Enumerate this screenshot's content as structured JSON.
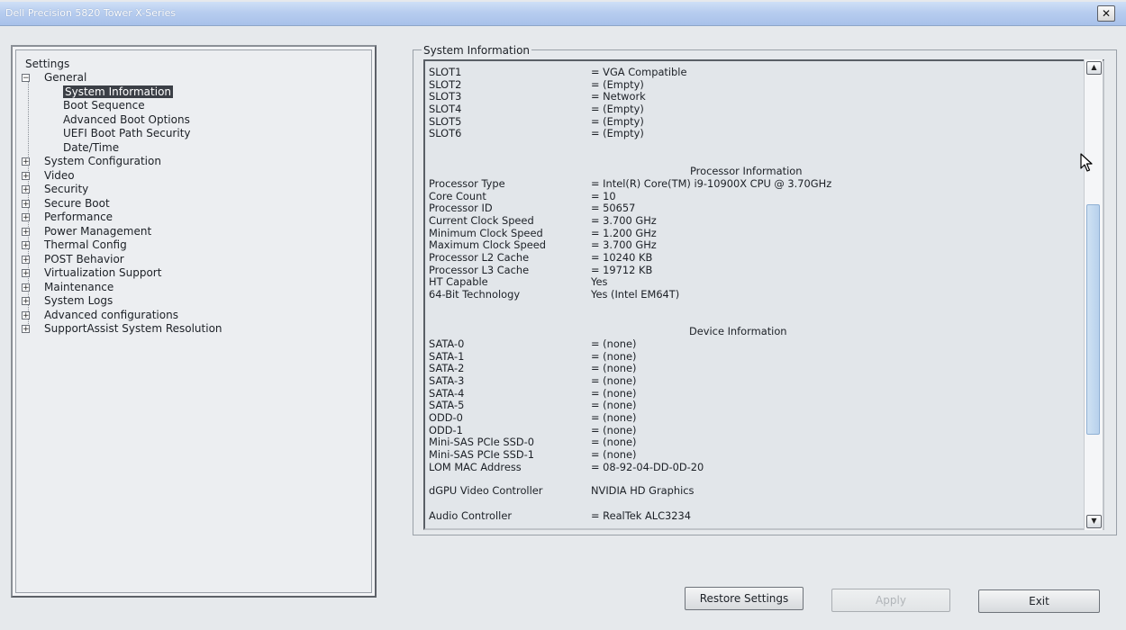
{
  "window": {
    "title": "Dell Precision 5820 Tower X-Series",
    "close_glyph": "✕"
  },
  "tree": {
    "root": "Settings",
    "general": {
      "label": "General",
      "expander": "−",
      "children": [
        "System Information",
        "Boot Sequence",
        "Advanced Boot Options",
        "UEFI Boot Path Security",
        "Date/Time"
      ]
    },
    "collapsed_expander": "+",
    "categories": [
      "System Configuration",
      "Video",
      "Security",
      "Secure Boot",
      "Performance",
      "Power Management",
      "Thermal Config",
      "POST Behavior",
      "Virtualization Support",
      "Maintenance",
      "System Logs",
      "Advanced configurations",
      "SupportAssist System Resolution"
    ]
  },
  "panel": {
    "title": "System Information",
    "slots": [
      {
        "label": "SLOT1",
        "value": "= VGA Compatible"
      },
      {
        "label": "SLOT2",
        "value": "= (Empty)"
      },
      {
        "label": "SLOT3",
        "value": "= Network"
      },
      {
        "label": "SLOT4",
        "value": "= (Empty)"
      },
      {
        "label": "SLOT5",
        "value": "= (Empty)"
      },
      {
        "label": "SLOT6",
        "value": "= (Empty)"
      }
    ],
    "processor_heading": "Processor Information",
    "processor": [
      {
        "label": "Processor Type",
        "value": "= Intel(R) Core(TM) i9-10900X CPU @ 3.70GHz"
      },
      {
        "label": "Core Count",
        "value": "= 10"
      },
      {
        "label": "Processor ID",
        "value": "= 50657"
      },
      {
        "label": "Current Clock Speed",
        "value": "= 3.700 GHz"
      },
      {
        "label": "Minimum Clock Speed",
        "value": "= 1.200 GHz"
      },
      {
        "label": "Maximum Clock Speed",
        "value": "= 3.700 GHz"
      },
      {
        "label": "Processor L2 Cache",
        "value": "= 10240 KB"
      },
      {
        "label": "Processor L3 Cache",
        "value": "= 19712 KB"
      },
      {
        "label": "HT Capable",
        "value": "Yes"
      },
      {
        "label": "64-Bit Technology",
        "value": "Yes (Intel EM64T)"
      }
    ],
    "device_heading": "Device Information",
    "devices": [
      {
        "label": "SATA-0",
        "value": "= (none)"
      },
      {
        "label": "SATA-1",
        "value": "= (none)"
      },
      {
        "label": "SATA-2",
        "value": "= (none)"
      },
      {
        "label": "SATA-3",
        "value": "= (none)"
      },
      {
        "label": "SATA-4",
        "value": "= (none)"
      },
      {
        "label": "SATA-5",
        "value": "= (none)"
      },
      {
        "label": "ODD-0",
        "value": "= (none)"
      },
      {
        "label": "ODD-1",
        "value": "= (none)"
      },
      {
        "label": "Mini-SAS PCIe SSD-0",
        "value": "= (none)"
      },
      {
        "label": "Mini-SAS PCIe SSD-1",
        "value": "= (none)"
      },
      {
        "label": "LOM MAC Address",
        "value": "= 08-92-04-DD-0D-20"
      }
    ],
    "dgpu": {
      "label": "dGPU Video Controller",
      "value": "NVIDIA HD Graphics"
    },
    "audio": {
      "label": "Audio Controller",
      "value": "= RealTek ALC3234"
    },
    "scroll_up_glyph": "▲",
    "scroll_down_glyph": "▼",
    "scroll_position": 0.62
  },
  "buttons": {
    "restore": "Restore Settings",
    "apply": "Apply",
    "exit": "Exit"
  }
}
